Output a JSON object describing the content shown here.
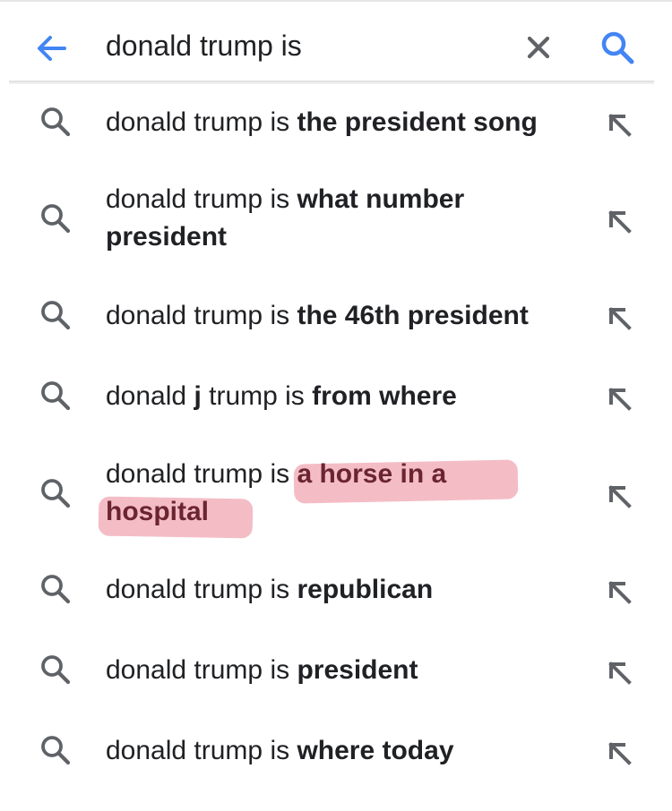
{
  "search": {
    "query": "donald trump is",
    "back_icon": "arrow-back-icon",
    "clear_icon": "close-icon",
    "submit_icon": "search-icon",
    "accent_color": "#4285f4"
  },
  "suggestions": [
    {
      "plain": "donald trump is ",
      "bold": "the president song"
    },
    {
      "plain": "donald trump is ",
      "bold": "what number president"
    },
    {
      "plain": "donald trump is ",
      "bold": "the 46th president"
    },
    {
      "plain_a": "donald ",
      "bold_a": "j",
      "plain": " trump is ",
      "bold": "from where"
    },
    {
      "plain": "donald trump is ",
      "bold": "a horse in a hospital",
      "highlighted": true,
      "highlight_color": "#e46276"
    },
    {
      "plain": "donald trump is ",
      "bold": "republican"
    },
    {
      "plain": "donald trump is ",
      "bold": "president"
    },
    {
      "plain": "donald trump is ",
      "bold": "where today"
    }
  ],
  "suggestion_icon": "search-icon",
  "fill_icon": "arrow-up-left-icon"
}
